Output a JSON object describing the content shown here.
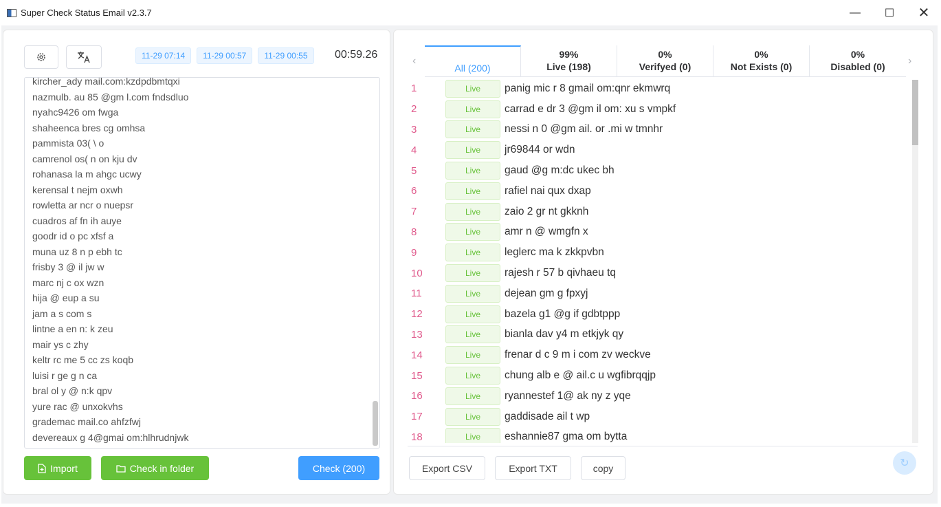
{
  "window": {
    "title": "Super Check Status Email v2.3.7",
    "minimize": "—",
    "maximize": "☐",
    "close": "✕"
  },
  "toolbar": {
    "timestamps": [
      "11-29 07:14",
      "11-29 00:57",
      "11-29 00:55"
    ],
    "elapsed": "00:59.26"
  },
  "input_list": [
    "kircher_ady   mail.com:kzdpdbmtqxi",
    "nazmulb.   au 85 @gm   l.com   fndsdluo",
    "nyahc9426   om  fwga",
    "shaheenca  bres      cg   omhsa",
    "pammista  03(           \\ o",
    "camrenol  os(     n  on   kju  dv",
    "rohanasa  la     m ahgc  ucwy",
    "kerensal     t      nejm  oxwh",
    "rowletta      ar      ncr o nuepsr",
    "cuadros   af         fn ih auye",
    "goodr   id         o  pc xfsf a",
    "muna   uz  8      n  p  ebh  tc",
    "frisby   3  @   il       jw  w",
    "marc     nj          c    ox  wzn",
    "hija    @          eup  a  su",
    "jam  a    s         com  s",
    "lintne  a  en         n:  k    zeu",
    "mair  ys           c       zhy",
    "keltr  rc  me  5       cc    zs   koqb",
    "luisi   r  ge  g        n       ca",
    "bral  ol  y  @       n:k      qpv",
    "yure  rac       @       unxokvhs",
    "grademac        mail.co     ahfzfwj",
    "devereaux    g    4@gmai   om:hlhrudnjwk"
  ],
  "left_buttons": {
    "import": "Import",
    "check_folder": "Check in folder",
    "check": "Check (200)"
  },
  "tabs": [
    {
      "pct": "",
      "label": "All (200)"
    },
    {
      "pct": "99%",
      "label": "Live (198)"
    },
    {
      "pct": "0%",
      "label": "Verifyed (0)"
    },
    {
      "pct": "0%",
      "label": "Not Exists (0)"
    },
    {
      "pct": "0%",
      "label": "Disabled (0)"
    }
  ],
  "nav": {
    "prev": "‹",
    "next": "›"
  },
  "results": [
    {
      "num": "1",
      "status": "Live",
      "email": "panig  mic   r  8   gmail  om:qnr   ekmwrq"
    },
    {
      "num": "2",
      "status": "Live",
      "email": "carrad     e   dr  3  @gm  il  om:  xu  s  vmpkf"
    },
    {
      "num": "3",
      "status": "Live",
      "email": "nessi  n          0  @gm  ail.  or  .mi    w  tmnhr"
    },
    {
      "num": "4",
      "status": "Live",
      "email": "jr69844          or           wdn"
    },
    {
      "num": "5",
      "status": "Live",
      "email": "gaud           @g        m:dc  ukec  bh"
    },
    {
      "num": "6",
      "status": "Live",
      "email": "rafiel             nai        qux  dxap"
    },
    {
      "num": "7",
      "status": "Live",
      "email": "zaio          2   gr     nt  gkknh"
    },
    {
      "num": "8",
      "status": "Live",
      "email": "amr   n          @          wmgfn   x"
    },
    {
      "num": "9",
      "status": "Live",
      "email": "leglerc       ma          k  zkkpvbn"
    },
    {
      "num": "10",
      "status": "Live",
      "email": "rajesh      r   57        b   qivhaeu   tq"
    },
    {
      "num": "11",
      "status": "Live",
      "email": "dejean       gm          g   fpxyj"
    },
    {
      "num": "12",
      "status": "Live",
      "email": "bazela  g1   @g          if   gdbtppp"
    },
    {
      "num": "13",
      "status": "Live",
      "email": "bianla  dav    y4        m    etkjyk  qy"
    },
    {
      "num": "14",
      "status": "Live",
      "email": "frenar  d    c        9      m  i com    zv   weckve"
    },
    {
      "num": "15",
      "status": "Live",
      "email": "chung  alb      e       @    ail.c     u  wgfibrqqjp"
    },
    {
      "num": "16",
      "status": "Live",
      "email": "ryannestef      1@              ak  ny   z  yqe"
    },
    {
      "num": "17",
      "status": "Live",
      "email": "gaddisade        ail         t   wp"
    },
    {
      "num": "18",
      "status": "Live",
      "email": "eshannie87   gma     om        bytta"
    }
  ],
  "right_buttons": {
    "export_csv": "Export CSV",
    "export_txt": "Export TXT",
    "copy": "copy"
  }
}
